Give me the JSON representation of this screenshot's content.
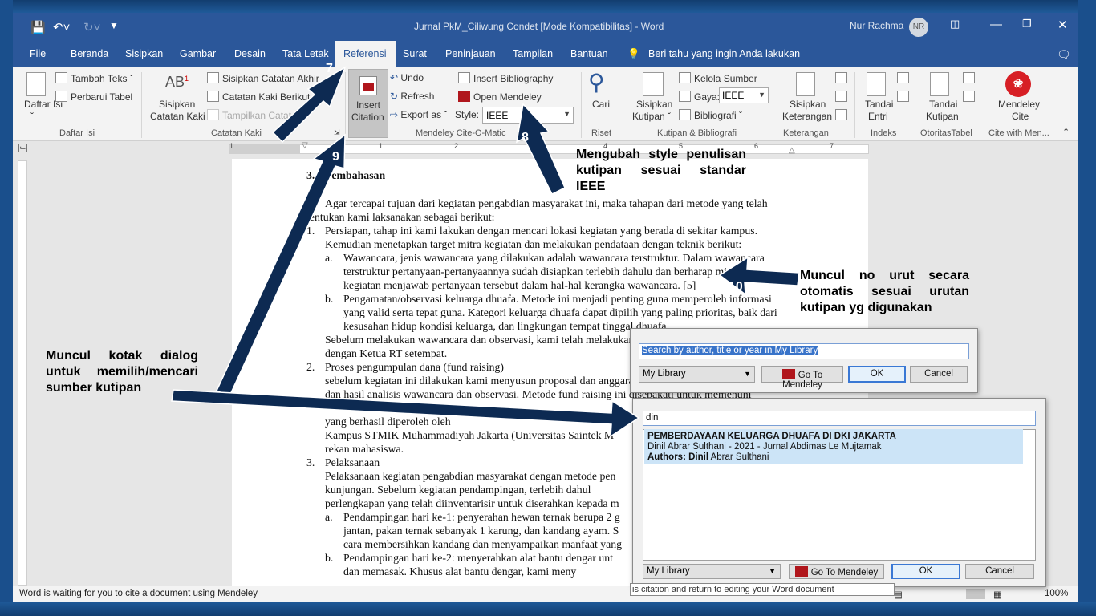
{
  "title": {
    "doc": "Jurnal PkM_Ciliwung Condet [Mode Kompatibilitas]  -  Word",
    "user": "Nur Rachma",
    "initials": "NR"
  },
  "tabs": [
    "File",
    "Beranda",
    "Sisipkan",
    "Gambar",
    "Desain",
    "Tata Letak",
    "Referensi",
    "Surat",
    "Peninjauan",
    "Tampilan",
    "Bantuan"
  ],
  "tell_me": "Beri tahu yang ingin Anda lakukan",
  "ribbon": {
    "daftar_isi": "Daftar Isi",
    "tambah_teks": "Tambah Teks",
    "perbarui_tabel": "Perbarui Tabel",
    "sisipkan_catatan_kaki_1": "Sisipkan",
    "sisipkan_catatan_kaki_2": "Catatan Kaki",
    "sisipkan_catatan_akhir": "Sisipkan Catatan Akhir",
    "catatan_kaki_berikut": "Catatan Kaki Berikut",
    "tampilkan_catatan": "Tampilkan Catatan",
    "insert_citation_1": "Insert",
    "insert_citation_2": "Citation",
    "undo": "Undo",
    "refresh": "Refresh",
    "export_as": "Export as",
    "insert_bibliography": "Insert Bibliography",
    "open_mendeley": "Open Mendeley",
    "style_label": "Style:",
    "style_value": "IEEE",
    "cari": "Cari",
    "sisipkan_kutipan_1": "Sisipkan",
    "sisipkan_kutipan_2": "Kutipan",
    "kelola_sumber": "Kelola Sumber",
    "gaya_label": "Gaya:",
    "gaya_value": "IEEE",
    "bibliografi": "Bibliografi",
    "sisipkan_keterangan_1": "Sisipkan",
    "sisipkan_keterangan_2": "Keterangan",
    "tandai_entri_1": "Tandai",
    "tandai_entri_2": "Entri",
    "tandai_kutipan_1": "Tandai",
    "tandai_kutipan_2": "Kutipan",
    "mendeley_cite_1": "Mendeley",
    "mendeley_cite_2": "Cite",
    "groups": {
      "daftar_isi": "Daftar Isi",
      "catatan_kaki": "Catatan Kaki",
      "cite_o_matic": "Mendeley Cite-O-Matic",
      "riset": "Riset",
      "kutipan": "Kutipan & Bibliografi",
      "keterangan": "Keterangan",
      "indeks": "Indeks",
      "otoritas": "OtoritasTabel",
      "cite_with": "Cite with Men..."
    }
  },
  "ruler": [
    "1",
    "1",
    "2",
    "3",
    "4",
    "5",
    "6",
    "7"
  ],
  "document": {
    "heading_num": "3.",
    "heading": "Pembahasan",
    "lines": [
      "Agar tercapai tujuan dari kegiatan pengabdian masyarakat ini, maka tahapan dari metode yang telah",
      "tentukan kami laksanakan sebagai berikut:",
      "Persiapan, tahap ini kami lakukan dengan mencari lokasi kegiatan yang berada di sekitar kampus.",
      "Kemudian menetapkan target mitra kegiatan dan melakukan pendataan dengan teknik berikut:",
      "Wawancara, jenis wawancara yang dilakukan adalah wawancara terstruktur. Dalam wawancara",
      "terstruktur pertanyaan-pertanyaannya sudah disiapkan terlebih dahulu dan berharap mitra",
      "kegiatan menjawab pertanyaan tersebut dalam hal-hal kerangka wawancara. [5]",
      "Pengamatan/observasi keluarga dhuafa.  Metode ini menjadi penting guna memperoleh informasi",
      "yang valid serta tepat guna. Kategori keluarga dhuafa dapat dipilih yang paling prioritas, baik dari",
      "kesusahan hidup kondisi keluarga, dan lingkungan tempat tinggal dhuafa.",
      "Sebelum melakukan wawancara dan observasi, kami telah melakukan",
      "dengan Ketua RT setempat.",
      "Proses pengumpulan dana (fund raising)",
      "sebelum kegiatan ini dilakukan kami menyusun proposal dan anggaran",
      "dan hasil analisis wawancara dan observasi. Metode fund raising ini disepakati untuk memenuhi",
      "yang berhasil diperoleh oleh",
      "Kampus STMIK Muhammadiyah Jakarta (Universitas Saintek M",
      "rekan mahasiswa.",
      "Pelaksanaan",
      "Pelaksanaan kegiatan pengabdian masyarakat dengan metode pen",
      "kunjungan. Sebelum kegiatan pendampingan, terlebih dahul",
      "perlengkapan yang telah diinventarisir untuk diserahkan kepada m",
      "Pendampingan hari ke-1: penyerahan hewan ternak berupa 2 g",
      "jantan, pakan ternak sebanyak 1 karung, dan kandang ayam. S",
      "cara membersihkan kandang dan menyampaikan manfaat yang",
      "Pendampingan hari ke-2: menyerahkan alat bantu dengar unt",
      "dan memasak. Khusus alat bantu dengar, kami meny"
    ],
    "markers": [
      "1.",
      "a.",
      "b.",
      "2.",
      "3.",
      "a.",
      "b."
    ]
  },
  "dialog1": {
    "search_placeholder": "Search by author, title or year in My Library",
    "library": "My Library",
    "go_to": "Go To Mendeley",
    "ok": "OK",
    "cancel": "Cancel"
  },
  "dialog2": {
    "search_value": "din",
    "result_title": "PEMBERDAYAAN KELUARGA DHUAFA DI DKI JAKARTA",
    "result_meta": "Dinil Abrar Sulthani - 2021 - Jurnal Abdimas Le Mujtamak",
    "result_authors_label": "Authors:",
    "result_authors_bold": "Dinil",
    "result_authors_rest": "Abrar Sulthani",
    "library": "My Library",
    "go_to": "Go To Mendeley",
    "ok": "OK",
    "cancel": "Cancel",
    "tooltip": "is citation and return to editing your Word document"
  },
  "status": {
    "message": "Word is waiting for you to cite a document using Mendeley",
    "zoom": "100%"
  },
  "annotations": {
    "n7": "7",
    "n8": "8",
    "n9": "9",
    "n10": "10",
    "style_note_1": "Mengubah style penulisan",
    "style_note_2": "kutipan sesuai standar",
    "style_note_3": "IEEE",
    "numbering_note_1": "Muncul no urut secara",
    "numbering_note_2": "otomatis sesuai urutan",
    "numbering_note_3": "kutipan yg digunakan",
    "dialog_note_1": "Muncul kotak dialog",
    "dialog_note_2": "untuk memilih/mencari",
    "dialog_note_3": "sumber kutipan"
  },
  "colors": {
    "word_blue": "#2b579a",
    "arrow_navy": "#0d2a52",
    "mendeley_red": "#d71f25",
    "selection_blue": "#3873c9"
  }
}
